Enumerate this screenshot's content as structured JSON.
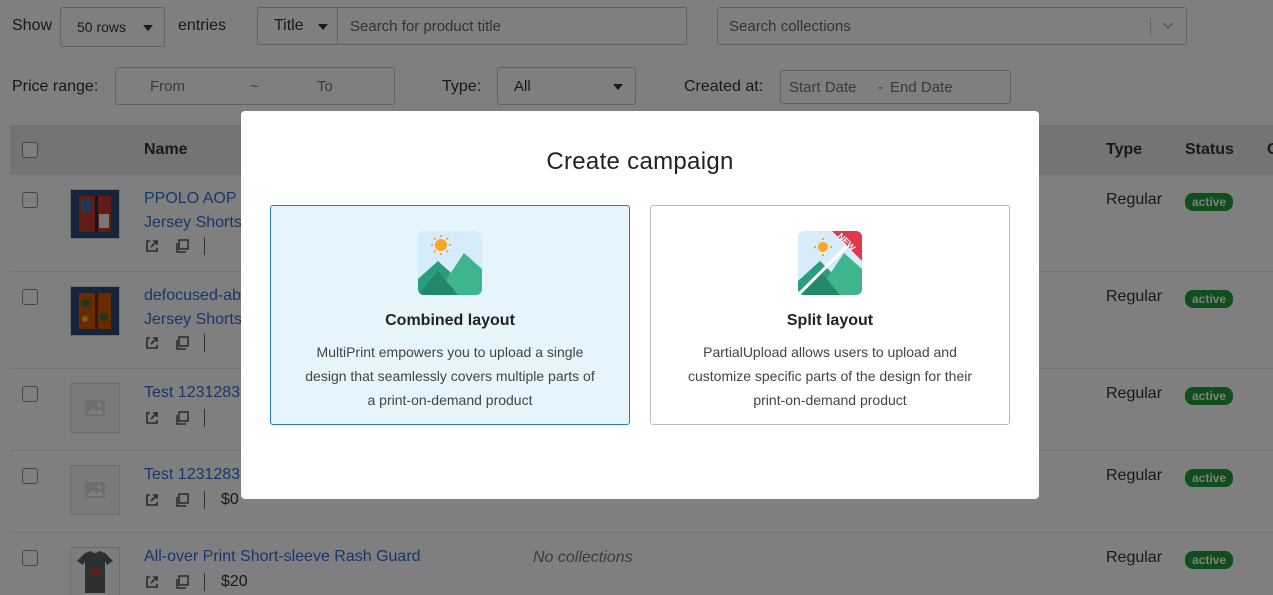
{
  "filters": {
    "show_label": "Show",
    "rows_value": "50 rows",
    "entries_label": "entries",
    "title_select": "Title",
    "search_product_placeholder": "Search for product title",
    "search_collections_placeholder": "Search collections",
    "price_range_label": "Price range:",
    "from_placeholder": "From",
    "range_sep": "~",
    "to_placeholder": "To",
    "type_label": "Type:",
    "type_value": "All",
    "created_at_label": "Created at:",
    "start_date_placeholder": "Start Date",
    "date_sep": "-",
    "end_date_placeholder": "End Date"
  },
  "table": {
    "headers": {
      "name": "Name",
      "type": "Type",
      "status": "Status",
      "extra": "C"
    },
    "rows": [
      {
        "name_line1": "PPOLO AOP F",
        "name_line2": "Jersey Shorts",
        "price": "",
        "collections": "",
        "type": "Regular",
        "status": "active",
        "thumb": "shorts-blue"
      },
      {
        "name_line1": "defocused-ab",
        "name_line2": "Jersey Shorts",
        "price": "",
        "collections": "",
        "type": "Regular",
        "status": "active",
        "thumb": "shorts-orange"
      },
      {
        "name_line1": "Test 1231283",
        "name_line2": "",
        "price": "",
        "collections": "",
        "type": "Regular",
        "status": "active",
        "thumb": "placeholder"
      },
      {
        "name_line1": "Test 1231283",
        "name_line2": "",
        "price": "$0",
        "collections": "",
        "type": "Regular",
        "status": "active",
        "thumb": "placeholder"
      },
      {
        "name_line1": "All-over Print Short-sleeve Rash Guard",
        "name_line2": "",
        "price": "$20",
        "collections": "No collections",
        "type": "Regular",
        "status": "active",
        "thumb": "shirt-grey"
      }
    ]
  },
  "modal": {
    "title": "Create campaign",
    "options": [
      {
        "title": "Combined layout",
        "desc_lines": [
          "MultiPrint empowers you to upload a single",
          "design that seamlessly covers multiple parts of",
          "a print-on-demand product"
        ],
        "badge": ""
      },
      {
        "title": "Split layout",
        "desc_lines": [
          "PartialUpload allows users to upload and",
          "customize specific parts of the design for their",
          "print-on-demand product"
        ],
        "badge": "NEW"
      }
    ]
  },
  "colors": {
    "link": "#2f6fd6",
    "active_badge": "#1f9d3a",
    "selected_card_bg": "#e6f4fc",
    "selected_card_border": "#1e7dbf",
    "new_ribbon": "#e2384d",
    "mountain": "#2a9d7c"
  }
}
